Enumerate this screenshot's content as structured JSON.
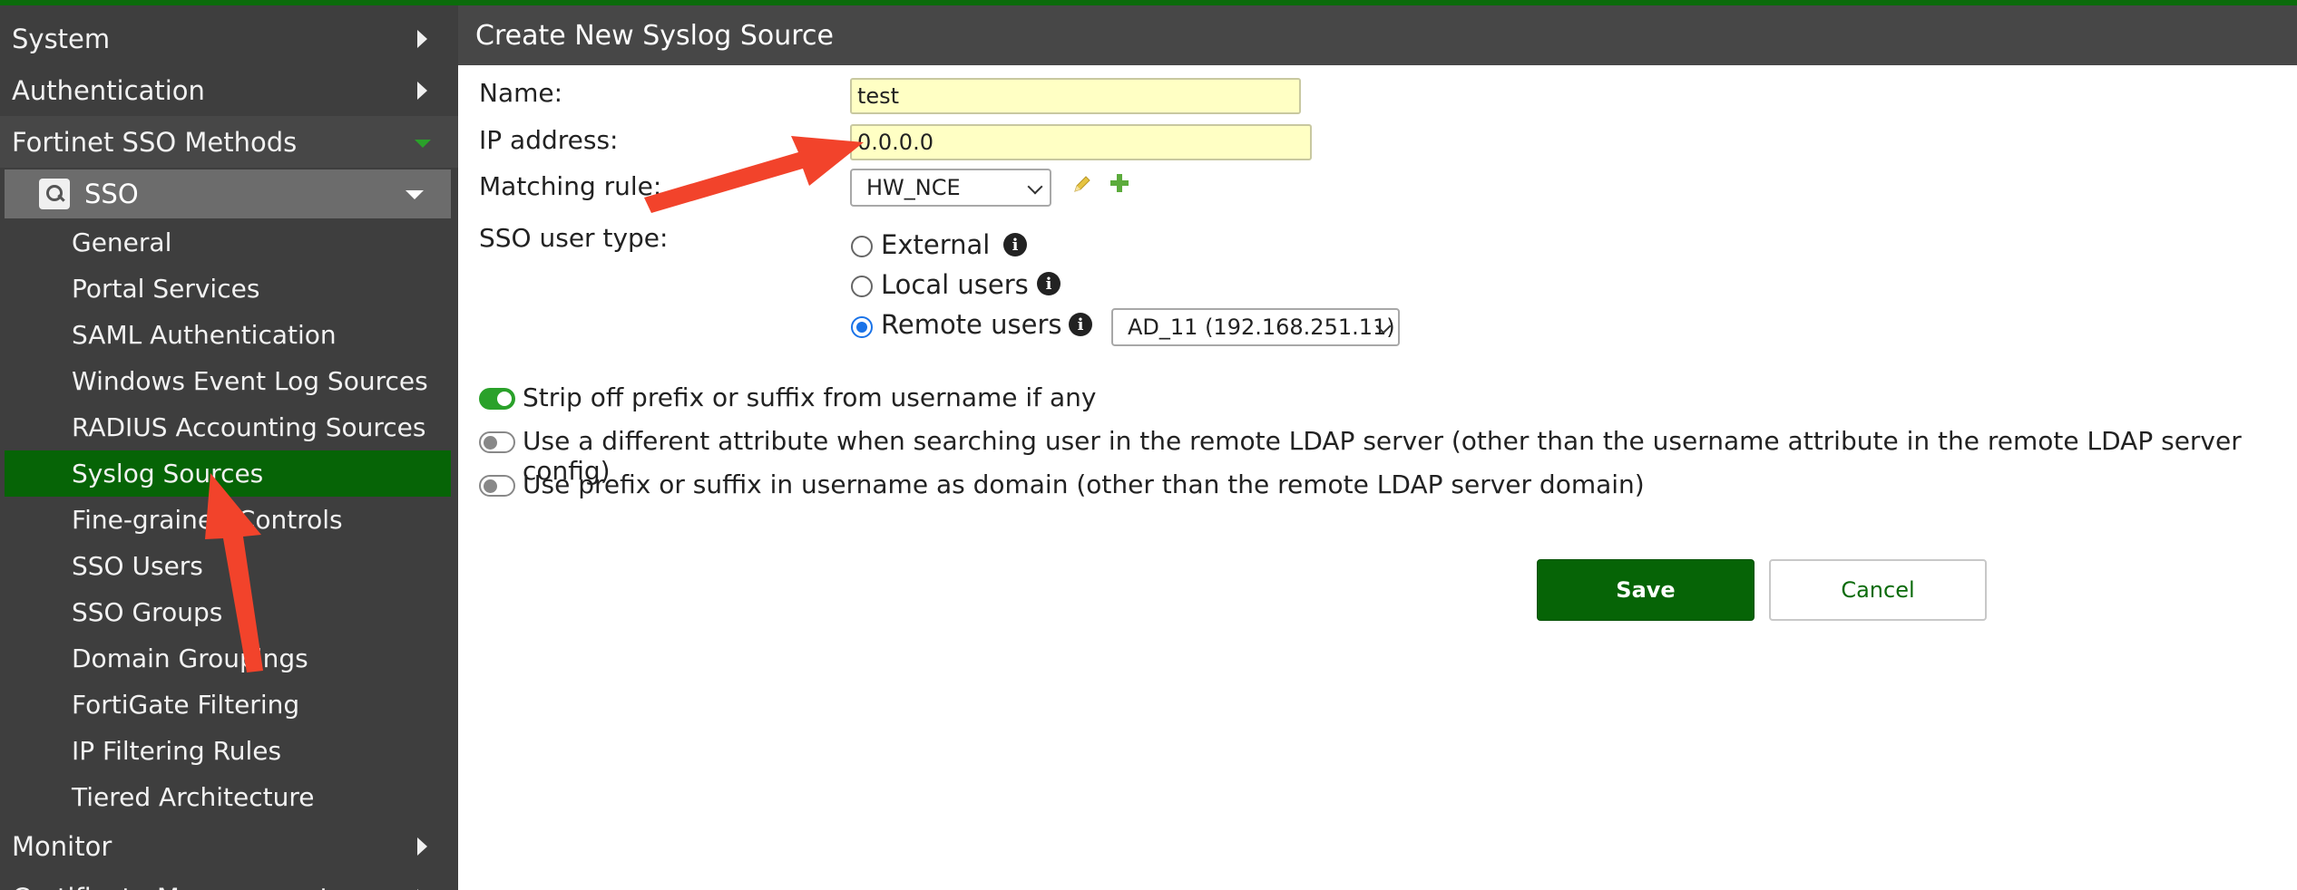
{
  "sidebar": {
    "top_items": [
      {
        "label": "System"
      },
      {
        "label": "Authentication"
      },
      {
        "label": "Fortinet SSO Methods"
      }
    ],
    "sso": {
      "label": "SSO"
    },
    "sub_items": [
      {
        "label": "General"
      },
      {
        "label": "Portal Services"
      },
      {
        "label": "SAML Authentication"
      },
      {
        "label": "Windows Event Log Sources"
      },
      {
        "label": "RADIUS Accounting Sources"
      },
      {
        "label": "Syslog Sources"
      },
      {
        "label": "Fine-grained Controls"
      },
      {
        "label": "SSO Users"
      },
      {
        "label": "SSO Groups"
      },
      {
        "label": "Domain Groupings"
      },
      {
        "label": "FortiGate Filtering"
      },
      {
        "label": "IP Filtering Rules"
      },
      {
        "label": "Tiered Architecture"
      }
    ],
    "bottom_items": [
      {
        "label": "Monitor"
      },
      {
        "label": "Certificate Management"
      }
    ],
    "active_item": "Syslog Sources"
  },
  "header": {
    "title": "Create New Syslog Source"
  },
  "form": {
    "name_label": "Name:",
    "name_value": "test",
    "ip_label": "IP address:",
    "ip_value": "0.0.0.0",
    "matching_label": "Matching rule:",
    "matching_value": "HW_NCE",
    "usertype_label": "SSO user type:",
    "radios": [
      {
        "label": "External",
        "selected": false
      },
      {
        "label": "Local users",
        "selected": false
      },
      {
        "label": "Remote users",
        "selected": true
      }
    ],
    "remote_server_value": "AD_11 (192.168.251.11)",
    "toggles": [
      {
        "label": "Strip off prefix or suffix from username if any",
        "on": true
      },
      {
        "label": "Use a different attribute when searching user in the remote LDAP server (other than the username attribute in the remote LDAP server config)",
        "on": false
      },
      {
        "label": "Use prefix or suffix in username as domain (other than the remote LDAP server domain)",
        "on": false
      }
    ],
    "save_label": "Save",
    "cancel_label": "Cancel"
  },
  "icons": {
    "info": "info-icon",
    "pencil": "pencil-icon",
    "plus": "plus-icon"
  },
  "colors": {
    "accent_green": "#066406",
    "arrow_red": "#f2432b",
    "field_yellow": "#ffffc4"
  }
}
